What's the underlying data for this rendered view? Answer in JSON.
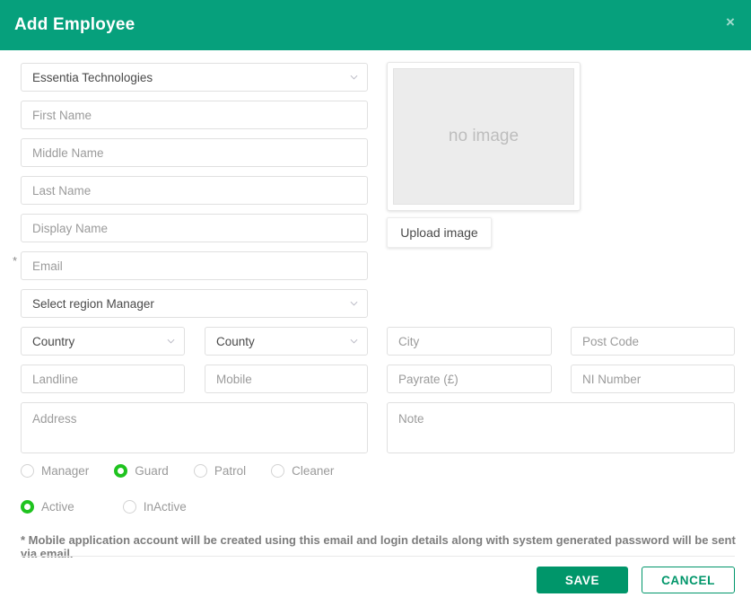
{
  "header": {
    "title": "Add Employee",
    "close_label": "×"
  },
  "colors": {
    "header_teal": "#06a07c",
    "save_teal": "#00966a",
    "radio_green": "#1fc31f",
    "border_gray": "#e0e0e0",
    "placeholder_gray": "#9b9b9b"
  },
  "form": {
    "company": {
      "value": "Essentia Technologies",
      "type": "select"
    },
    "first_name": {
      "placeholder": "First Name"
    },
    "middle_name": {
      "placeholder": "Middle Name"
    },
    "last_name": {
      "placeholder": "Last Name"
    },
    "display_name": {
      "placeholder": "Display Name"
    },
    "email": {
      "placeholder": "Email",
      "required_marker": "*"
    },
    "region_manager": {
      "value": "Select region Manager",
      "type": "select"
    },
    "country": {
      "value": "Country",
      "type": "select"
    },
    "county": {
      "value": "County",
      "type": "select"
    },
    "city": {
      "placeholder": "City"
    },
    "post_code": {
      "placeholder": "Post Code"
    },
    "landline": {
      "placeholder": "Landline"
    },
    "mobile": {
      "placeholder": "Mobile"
    },
    "payrate": {
      "placeholder": "Payrate (£)"
    },
    "ni_number": {
      "placeholder": "NI Number"
    },
    "address": {
      "placeholder": "Address"
    },
    "note": {
      "placeholder": "Note"
    }
  },
  "image_panel": {
    "placeholder_text": "no image",
    "upload_label": "Upload image"
  },
  "role_radios": {
    "selected": "Guard",
    "options": [
      {
        "label": "Manager",
        "selected": false
      },
      {
        "label": "Guard",
        "selected": true
      },
      {
        "label": "Patrol",
        "selected": false
      },
      {
        "label": "Cleaner",
        "selected": false
      }
    ]
  },
  "status_radios": {
    "selected": "Active",
    "options": [
      {
        "label": "Active",
        "selected": true
      },
      {
        "label": "InActive",
        "selected": false
      }
    ]
  },
  "footer": {
    "note": "* Mobile application account will be created using this email and login details along with system generated password will be sent via email.",
    "save_label": "SAVE",
    "cancel_label": "CANCEL"
  }
}
